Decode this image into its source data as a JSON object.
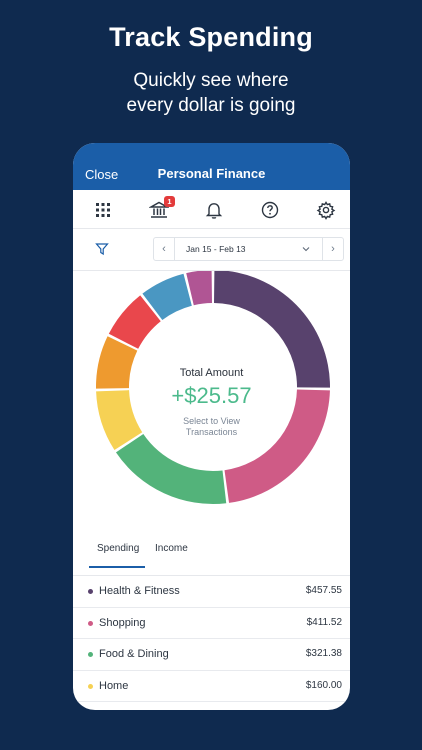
{
  "hero": {
    "title": "Track Spending",
    "subtitle_line1": "Quickly see where",
    "subtitle_line2": "every dollar is going"
  },
  "nav": {
    "close_label": "Close",
    "title": "Personal Finance"
  },
  "toolbar": {
    "icons": [
      "apps-grid-icon",
      "bank-icon",
      "bell-icon",
      "help-icon",
      "gear-icon"
    ],
    "bank_badge": "1",
    "badge_color": "#e33b3b"
  },
  "date_range": {
    "label": "Jan 15 - Feb 13",
    "prev": "‹",
    "next": "›"
  },
  "summary": {
    "label": "Total Amount",
    "amount": "+$25.57",
    "hint_line1": "Select to View",
    "hint_line2": "Transactions"
  },
  "tabs": [
    {
      "label": "Spending",
      "active": true
    },
    {
      "label": "Income",
      "active": false
    }
  ],
  "categories": [
    {
      "name": "Health & Fitness",
      "amount": "$457.55",
      "color": "#58426d"
    },
    {
      "name": "Shopping",
      "amount": "$411.52",
      "color": "#cf5b86"
    },
    {
      "name": "Food & Dining",
      "amount": "$321.38",
      "color": "#53b37a"
    },
    {
      "name": "Home",
      "amount": "$160.00",
      "color": "#f6d154"
    }
  ],
  "chart_data": {
    "type": "pie",
    "donut": true,
    "title": "Total Amount",
    "categories": [
      "Health & Fitness",
      "Shopping",
      "Food & Dining",
      "Home",
      "Orange category",
      "Red category",
      "Blue category",
      "Pink category"
    ],
    "values": [
      457.55,
      411.52,
      321.38,
      160.0,
      140.0,
      130.0,
      120.0,
      70.0
    ],
    "colors": [
      "#58426d",
      "#cf5b86",
      "#53b37a",
      "#f6d154",
      "#ee9a2f",
      "#e9474c",
      "#4a97c2",
      "#b05594"
    ]
  },
  "colors": {
    "brand": "#1b5ea8",
    "background": "#0f2a4f",
    "positive": "#4cba8c"
  }
}
